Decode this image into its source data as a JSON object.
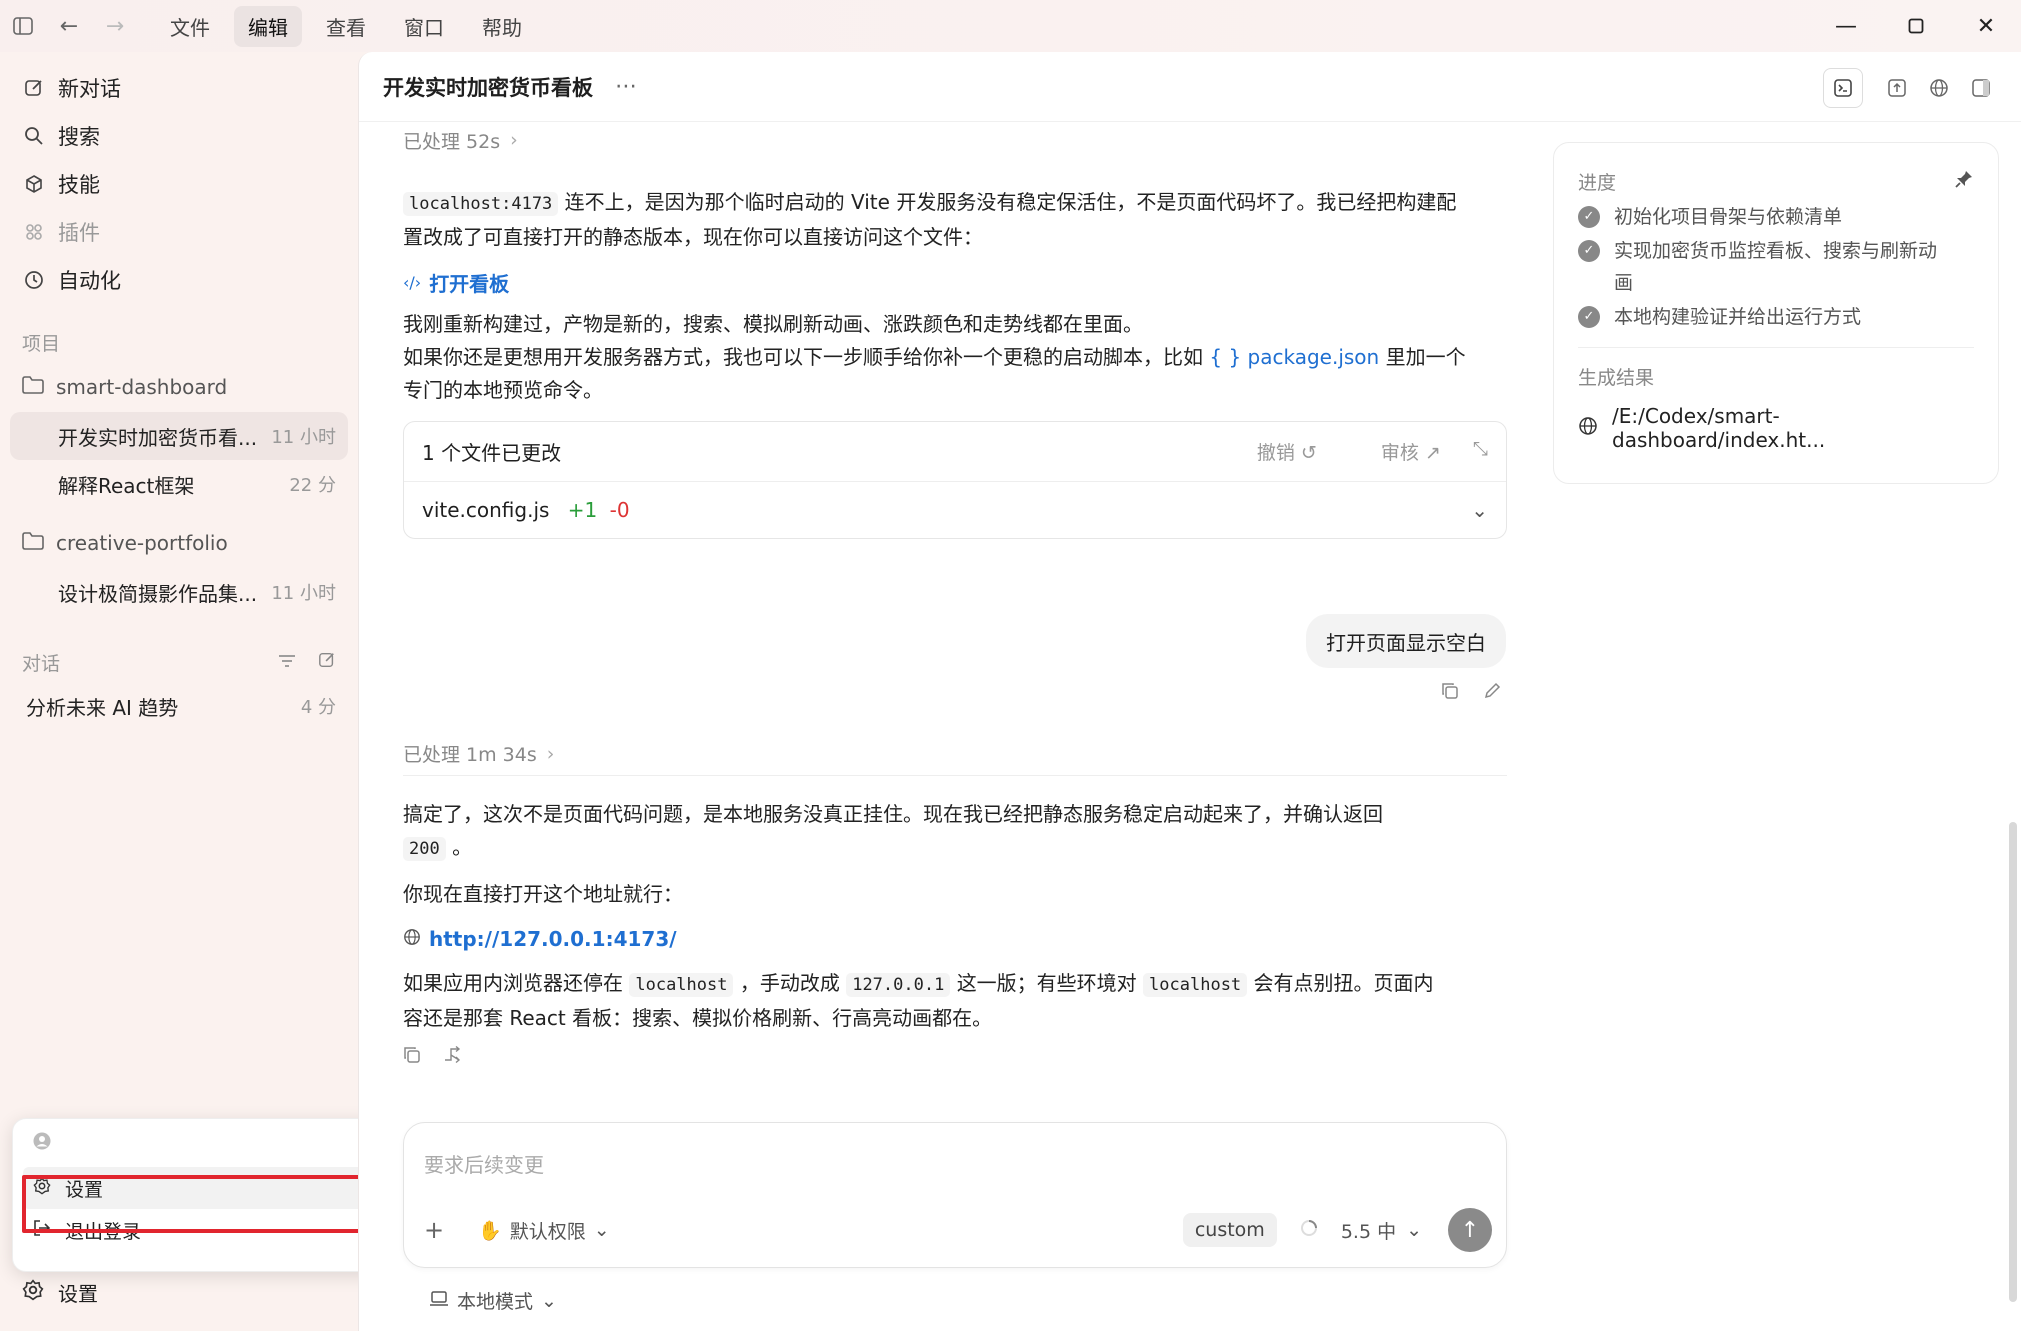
{
  "menu": {
    "items": [
      "文件",
      "编辑",
      "查看",
      "窗口",
      "帮助"
    ],
    "active_index": 1
  },
  "sidebar": {
    "nav": [
      {
        "label": "新对话",
        "icon": "edit-icon"
      },
      {
        "label": "搜索",
        "icon": "search-icon"
      },
      {
        "label": "技能",
        "icon": "cube-icon"
      },
      {
        "label": "插件",
        "icon": "grid-icon"
      },
      {
        "label": "自动化",
        "icon": "clock-icon"
      }
    ],
    "projects_label": "项目",
    "project1": {
      "name": "smart-dashboard",
      "convs": [
        {
          "title": "开发实时加密货币看...",
          "time": "11 小时"
        },
        {
          "title": "解释React框架",
          "time": "22 分"
        }
      ]
    },
    "project2": {
      "name": "creative-portfolio",
      "convs": [
        {
          "title": "设计极简摄影作品集...",
          "time": "11 小时"
        }
      ]
    },
    "conversations_label": "对话",
    "conversations": [
      {
        "title": "分析未来 AI 趋势",
        "time": "4 分"
      }
    ],
    "popup": {
      "settings": "设置",
      "logout": "退出登录"
    },
    "settings_label": "设置"
  },
  "header": {
    "title": "开发实时加密货币看板"
  },
  "chat": {
    "processed1": "已处理 52s",
    "p1_code": "localhost:4173",
    "p1_text_a": "连不上，是因为那个临时启动的 Vite 开发服务没有稳定保活住，不是页面代码坏了。我已经把构建配",
    "p1_text_b": "置改成了可直接打开的静态版本，现在你可以直接访问这个文件：",
    "open_board": "打开看板",
    "p2_line1": "我刚重新构建过，产物是新的，搜索、模拟刷新动画、涨跌颜色和走势线都在里面。",
    "p2_line2a": "如果你还是更想用开发服务器方式，我也可以下一步顺手给你补一个更稳的启动脚本，比如",
    "p2_link": "package.json",
    "p2_line2b": "里加一个",
    "p2_line3": "专门的本地预览命令。",
    "files": {
      "header": "1 个文件已更改",
      "undo": "撤销",
      "review": "审核",
      "name": "vite.config.js",
      "plus": "+1",
      "minus": "-0"
    },
    "user_msg": "打开页面显示空白",
    "processed2": "已处理 1m 34s",
    "p3_line1": "搞定了，这次不是页面代码问题，是本地服务没真正挂住。现在我已经把静态服务稳定启动起来了，并确认返回",
    "p3_code": "200",
    "p3_end": "。",
    "p4": "你现在直接打开这个地址就行：",
    "url": "http://127.0.0.1:4173/",
    "p5_a": "如果应用内浏览器还停在",
    "p5_code1": "localhost",
    "p5_b": "，手动改成",
    "p5_code2": "127.0.0.1",
    "p5_c": "这一版；有些环境对",
    "p5_code3": "localhost",
    "p5_d": "会有点别扭。页面内",
    "p5_line2": "容还是那套 React 看板：搜索、模拟价格刷新、行高亮动画都在。"
  },
  "panel": {
    "progress_label": "进度",
    "tasks": [
      "初始化项目骨架与依赖清单",
      "实现加密货币监控看板、搜索与刷新动",
      "画",
      "本地构建验证并给出运行方式"
    ],
    "result_label": "生成结果",
    "result_path": "/E:/Codex/smart-dashboard/index.ht..."
  },
  "composer": {
    "placeholder": "要求后续变更",
    "permission": "默认权限",
    "custom": "custom",
    "model": "5.5 中",
    "mode": "本地模式"
  }
}
